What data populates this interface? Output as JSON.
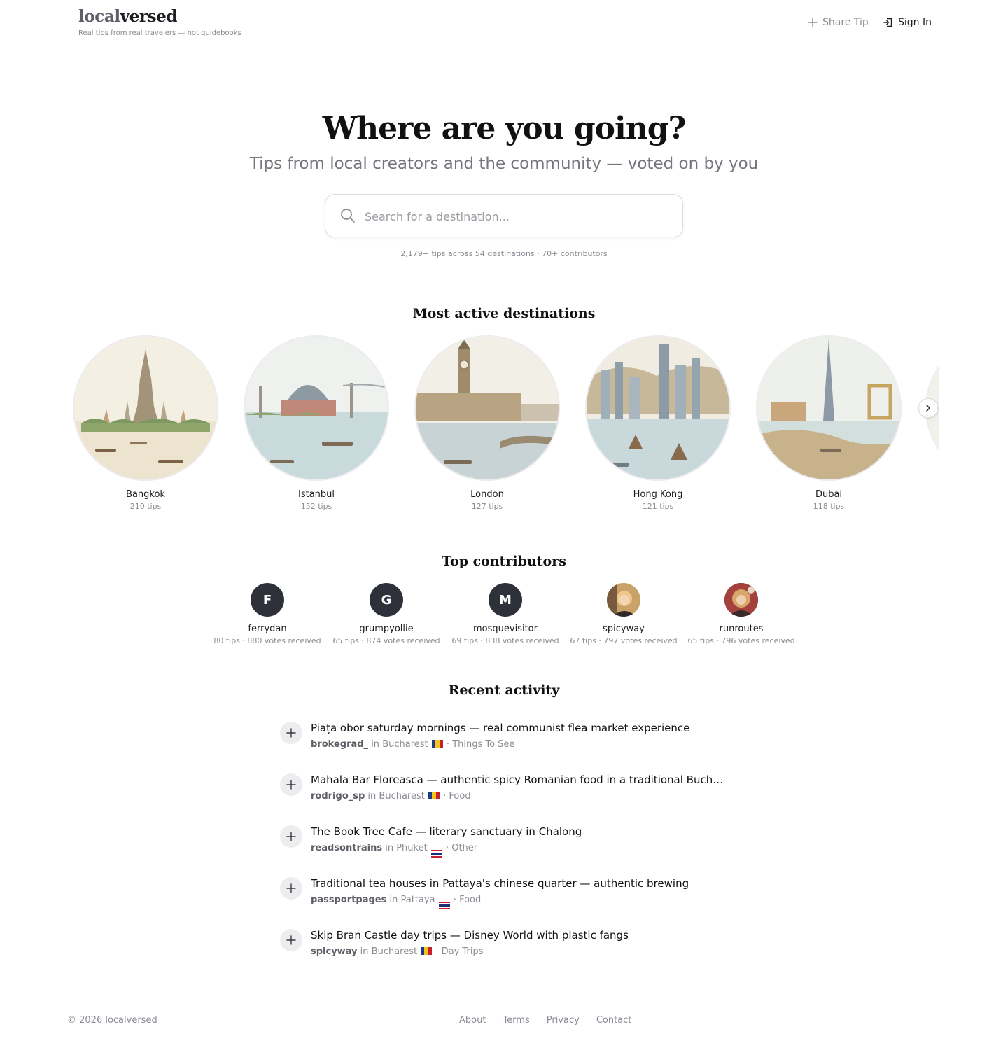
{
  "header": {
    "logo_part1": "local",
    "logo_part2": "versed",
    "tagline": "Real tips from real travelers — not guidebooks",
    "share_label": "Share Tip",
    "signin_label": "Sign In"
  },
  "hero": {
    "title": "Where are you going?",
    "subtitle": "Tips from local creators and the community — voted on by you",
    "search_placeholder": "Search for a destination...",
    "stats": "2,179+ tips across 54 destinations · 70+ contributors"
  },
  "destinations": {
    "title": "Most active destinations",
    "items": [
      {
        "name": "Bangkok",
        "count": "210 tips"
      },
      {
        "name": "Istanbul",
        "count": "152 tips"
      },
      {
        "name": "London",
        "count": "127 tips"
      },
      {
        "name": "Hong Kong",
        "count": "121 tips"
      },
      {
        "name": "Dubai",
        "count": "118 tips"
      }
    ]
  },
  "contributors": {
    "title": "Top contributors",
    "items": [
      {
        "initial": "F",
        "name": "ferrydan",
        "stats": "80 tips · 880 votes received"
      },
      {
        "initial": "G",
        "name": "grumpyollie",
        "stats": "65 tips · 874 votes received"
      },
      {
        "initial": "M",
        "name": "mosquevisitor",
        "stats": "69 tips · 838 votes received"
      },
      {
        "initial": "",
        "name": "spicyway",
        "stats": "67 tips · 797 votes received"
      },
      {
        "initial": "",
        "name": "runroutes",
        "stats": "65 tips · 796 votes received"
      }
    ]
  },
  "activity": {
    "title": "Recent activity",
    "items": [
      {
        "title": "Piața obor saturday mornings — real communist flea market experience",
        "user": "brokegrad_",
        "in_label": " in ",
        "city": "Bucharest",
        "category": " · Things To See"
      },
      {
        "title": "Mahala Bar Floreasca — authentic spicy Romanian food in a traditional Bucharest setting",
        "user": "rodrigo_sp",
        "in_label": " in ",
        "city": "Bucharest",
        "category": " · Food"
      },
      {
        "title": "The Book Tree Cafe — literary sanctuary in Chalong",
        "user": "readsontrains",
        "in_label": " in ",
        "city": "Phuket",
        "category": " · Other"
      },
      {
        "title": "Traditional tea houses in Pattaya's chinese quarter — authentic brewing",
        "user": "passportpages",
        "in_label": " in ",
        "city": "Pattaya",
        "category": " · Food"
      },
      {
        "title": "Skip Bran Castle day trips — Disney World with plastic fangs",
        "user": "spicyway",
        "in_label": " in ",
        "city": "Bucharest",
        "category": " · Day Trips"
      }
    ]
  },
  "footer": {
    "copyright": "© 2026 localversed",
    "links": [
      "About",
      "Terms",
      "Privacy",
      "Contact"
    ]
  },
  "colors": {
    "text": "#111114",
    "muted": "#8c8c95",
    "avatar_bg": "#2f313a",
    "border": "#e6e6e9"
  }
}
